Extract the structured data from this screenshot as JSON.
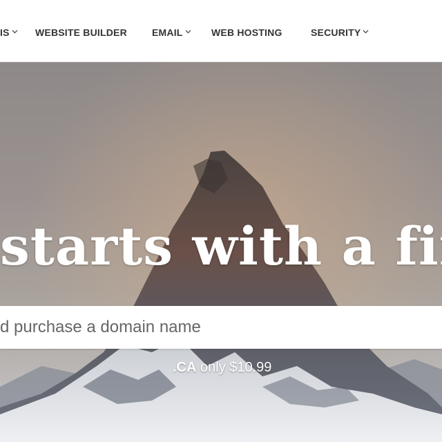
{
  "nav": {
    "items": [
      {
        "label": "IS",
        "has_dropdown": true
      },
      {
        "label": "WEBSITE BUILDER",
        "has_dropdown": false
      },
      {
        "label": "EMAIL",
        "has_dropdown": true
      },
      {
        "label": "WEB HOSTING",
        "has_dropdown": false
      },
      {
        "label": "SECURITY",
        "has_dropdown": true
      }
    ]
  },
  "hero": {
    "headline": "starts with a firs",
    "search": {
      "placeholder": "d purchase a domain name"
    },
    "promo": {
      "tld": ".CA",
      "text": " only $10.99"
    }
  },
  "colors": {
    "nav_text": "#333333",
    "hero_text": "#ffffff"
  }
}
